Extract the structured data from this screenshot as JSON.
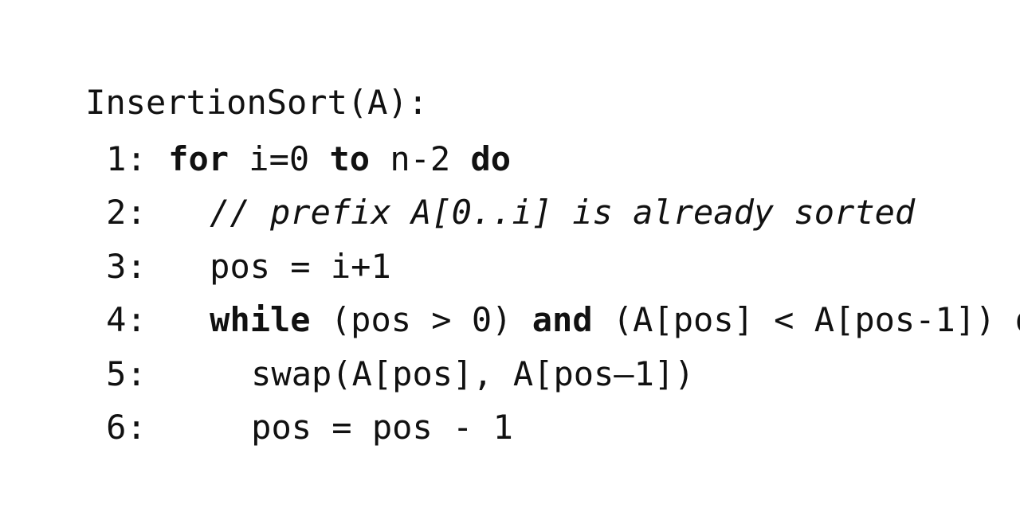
{
  "signature": "InsertionSort(A):",
  "lines": [
    {
      "number": "1:",
      "parts": [
        {
          "text": "for",
          "style": "keyword"
        },
        {
          "text": " i=0 ",
          "style": "plain"
        },
        {
          "text": "to",
          "style": "keyword"
        },
        {
          "text": " n-2 ",
          "style": "plain"
        },
        {
          "text": "do",
          "style": "keyword"
        }
      ]
    },
    {
      "number": "2:",
      "parts": [
        {
          "text": "// prefix A[0..i] is already sorted",
          "style": "comment"
        }
      ]
    },
    {
      "number": "3:",
      "parts": [
        {
          "text": "pos = i+1",
          "style": "plain"
        }
      ]
    },
    {
      "number": "4:",
      "parts": [
        {
          "text": "while",
          "style": "keyword"
        },
        {
          "text": " (pos > 0) ",
          "style": "plain"
        },
        {
          "text": "and",
          "style": "keyword"
        },
        {
          "text": " (A[pos] < A[pos-1]) ",
          "style": "plain"
        },
        {
          "text": "do",
          "style": "keyword"
        }
      ]
    },
    {
      "number": "5:",
      "parts": [
        {
          "text": "swap(A[pos], A[pos–1])",
          "style": "plain"
        }
      ]
    },
    {
      "number": "6:",
      "parts": [
        {
          "text": "pos = pos - 1",
          "style": "plain"
        }
      ]
    }
  ]
}
